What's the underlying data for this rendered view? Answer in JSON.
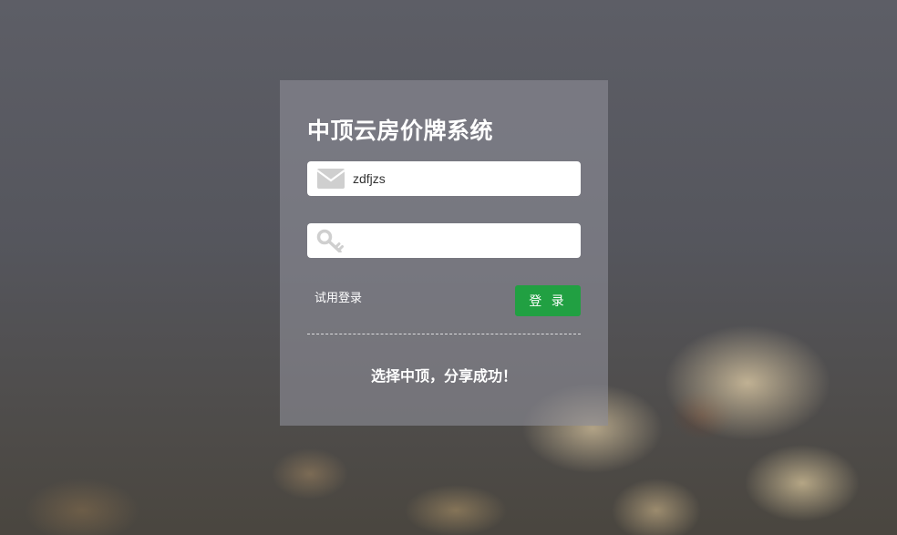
{
  "login": {
    "title": "中顶云房价牌系统",
    "username": {
      "value": "zdfjzs",
      "icon": "envelope-icon"
    },
    "password": {
      "value": "",
      "icon": "key-icon"
    },
    "trial_link": "试用登录",
    "submit_label": "登 录",
    "slogan": "选择中顶，分享成功！"
  },
  "colors": {
    "accent": "#21a042",
    "panel": "rgba(140,141,150,0.62)",
    "icon": "#cfcfcf"
  }
}
